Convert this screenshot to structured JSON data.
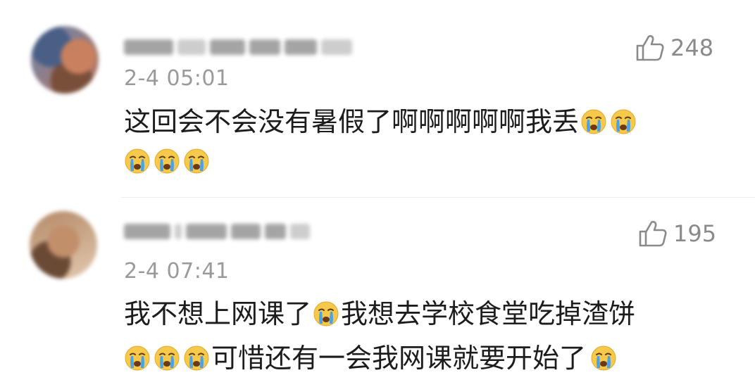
{
  "comments": [
    {
      "timestamp": "2-4 05:01",
      "likes": "248",
      "line1": {
        "text": "这回会不会没有暑假了啊啊啊啊啊我丢",
        "trailing_emojis": 2
      },
      "line2": {
        "leading_emojis": 3
      }
    },
    {
      "timestamp": "2-4 07:41",
      "likes": "195",
      "line1": {
        "part1": "我不想上网课了",
        "part2": "我想去学校食堂吃掉渣饼"
      },
      "line2": {
        "part1": "可惜还有一会我网课就要开始了"
      }
    }
  ],
  "icons": {
    "like": "thumbs-up-icon",
    "emoji": "crying-face-emoji"
  },
  "colors": {
    "text": "#1c1c1c",
    "meta": "#9a9a9a",
    "emoji_face": "#f7c94a",
    "emoji_tear": "#4aa3e8"
  }
}
